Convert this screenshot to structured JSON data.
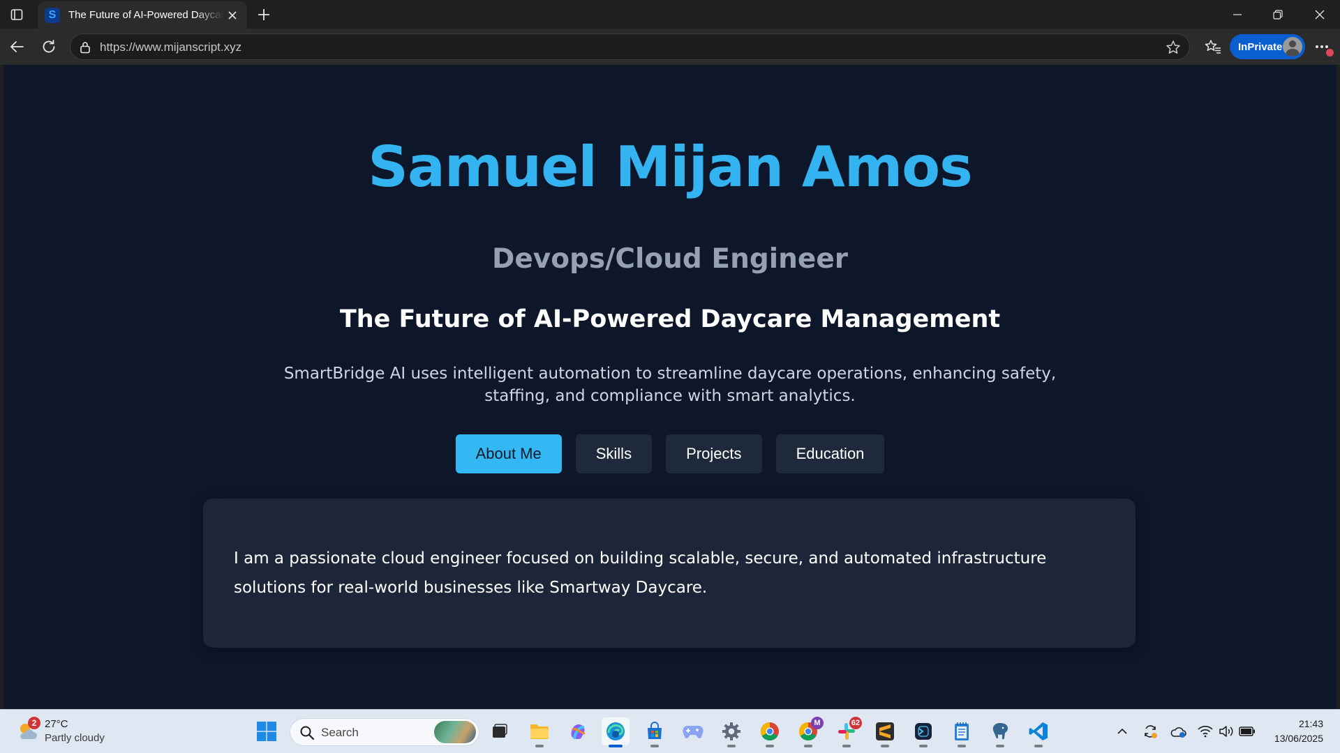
{
  "browser": {
    "tab_title": "The Future of AI-Powered Daycare Management",
    "favicon_letter": "S",
    "url": "https://www.mijanscript.xyz",
    "inprivate_label": "InPrivate"
  },
  "page": {
    "name": "Samuel Mijan Amos",
    "role": "Devops/Cloud Engineer",
    "headline": "The Future of AI-Powered Daycare Management",
    "description": "SmartBridge AI uses intelligent automation to streamline daycare operations, enhancing safety, staffing, and compliance with smart analytics.",
    "tabs": [
      {
        "label": "About Me",
        "active": true
      },
      {
        "label": "Skills",
        "active": false
      },
      {
        "label": "Projects",
        "active": false
      },
      {
        "label": "Education",
        "active": false
      }
    ],
    "about_text": "I am a passionate cloud engineer focused on building scalable, secure, and automated infrastructure solutions for real-world businesses like Smartway Daycare."
  },
  "taskbar": {
    "weather_badge": "2",
    "weather_temp": "27°C",
    "weather_condition": "Partly cloudy",
    "search_placeholder": "Search",
    "slack_badge": "62",
    "chrome_profile_letter": "M",
    "time": "21:43",
    "date": "13/06/2025"
  },
  "colors": {
    "accent": "#33b4f1",
    "page_bg": "#0e1629",
    "card_bg": "#1c2638"
  }
}
